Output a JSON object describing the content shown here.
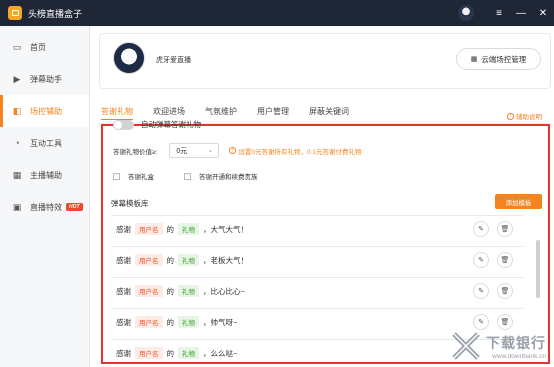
{
  "app": {
    "title": "头榜直播盒子",
    "controls": {
      "menu": "≡",
      "minimize": "—",
      "close": "✕"
    }
  },
  "sidebar": {
    "items": [
      {
        "label": "首页",
        "icon": "monitor-icon",
        "glyph": "▭"
      },
      {
        "label": "弹幕助手",
        "icon": "play-icon",
        "glyph": "▶"
      },
      {
        "label": "场控辅助",
        "icon": "broadcast-icon",
        "glyph": "◧",
        "active": true
      },
      {
        "label": "互动工具",
        "icon": "interact-icon",
        "glyph": "◔"
      },
      {
        "label": "主播辅助",
        "icon": "grid-icon",
        "glyph": "▦"
      },
      {
        "label": "直播特效",
        "icon": "camera-icon",
        "glyph": "▣",
        "badge": "HOT"
      }
    ]
  },
  "profile": {
    "name": "虎牙爱直播",
    "cloud_button": "云端场控管理"
  },
  "tabs": [
    "答谢礼物",
    "欢迎进场",
    "气氛维护",
    "用户管理",
    "屏蔽关键词"
  ],
  "active_tab": 0,
  "panel": {
    "help_link": "辅助说明",
    "toggle_label": "自动弹幕答谢礼物",
    "toggle_on": false,
    "value_label": "答谢礼物价值≥:",
    "value_selected": "0元",
    "value_hint": "设置0元答谢所有礼物，0.1元答谢付费礼物",
    "checkboxes": [
      {
        "label": "答谢礼盒",
        "checked": false
      },
      {
        "label": "答谢开通和续费贵族",
        "checked": false
      }
    ],
    "list_title": "弹幕模板库",
    "add_button": "添加模板",
    "templates": [
      {
        "prefix": "感谢",
        "user_tag": "用户名",
        "mid": "的",
        "gift_tag": "礼物",
        "suffix": "，大气大气！"
      },
      {
        "prefix": "感谢",
        "user_tag": "用户名",
        "mid": "的",
        "gift_tag": "礼物",
        "suffix": "，老板大气！"
      },
      {
        "prefix": "感谢",
        "user_tag": "用户名",
        "mid": "的",
        "gift_tag": "礼物",
        "suffix": "，比心比心~"
      },
      {
        "prefix": "感谢",
        "user_tag": "用户名",
        "mid": "的",
        "gift_tag": "礼物",
        "suffix": "，帅气呀~"
      },
      {
        "prefix": "感谢",
        "user_tag": "用户名",
        "mid": "的",
        "gift_tag": "礼物",
        "suffix": "，么么哒~"
      }
    ]
  },
  "watermark": {
    "main": "下载银行",
    "sub": "www.downbank.cn"
  },
  "colors": {
    "accent": "#f5841f",
    "highlight_border": "#e8322c",
    "titlebar": "#1f2635"
  }
}
